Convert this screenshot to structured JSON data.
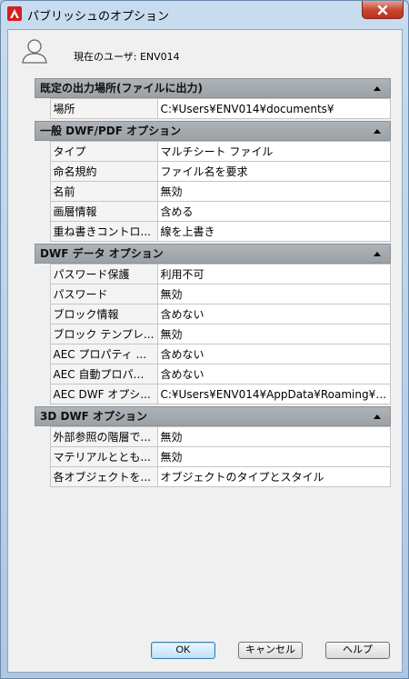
{
  "window": {
    "title": "パブリッシュのオプション"
  },
  "user": {
    "label": "現在のユーザ: ENV014"
  },
  "sections": [
    {
      "title": "既定の出力場所(ファイルに出力)",
      "rows": [
        {
          "name": "場所",
          "value": "C:¥Users¥ENV014¥documents¥"
        }
      ]
    },
    {
      "title": "一般 DWF/PDF オプション",
      "rows": [
        {
          "name": "タイプ",
          "value": "マルチシート ファイル"
        },
        {
          "name": "命名規約",
          "value": "ファイル名を要求"
        },
        {
          "name": "名前",
          "value": "無効"
        },
        {
          "name": "画層情報",
          "value": "含める"
        },
        {
          "name": "重ね書きコントロ...",
          "value": "線を上書き"
        }
      ]
    },
    {
      "title": "DWF データ オプション",
      "rows": [
        {
          "name": "パスワード保護",
          "value": "利用不可"
        },
        {
          "name": "パスワード",
          "value": "無効"
        },
        {
          "name": "ブロック情報",
          "value": "含めない"
        },
        {
          "name": "ブロック テンプレ...",
          "value": "無効"
        },
        {
          "name": "AEC プロパティ ...",
          "value": "含めない"
        },
        {
          "name": "AEC 自動プロパティ",
          "value": "含めない"
        },
        {
          "name": "AEC DWF オプシ...",
          "value": "C:¥Users¥ENV014¥AppData¥Roaming¥A..."
        }
      ]
    },
    {
      "title": "3D DWF オプション",
      "rows": [
        {
          "name": "外部参照の階層で...",
          "value": "無効"
        },
        {
          "name": "マテリアルととも...",
          "value": "無効"
        },
        {
          "name": "各オブジェクトを...",
          "value": "オブジェクトのタイプとスタイル"
        }
      ]
    }
  ],
  "buttons": {
    "ok": "OK",
    "cancel": "キャンセル",
    "help": "ヘルプ"
  }
}
